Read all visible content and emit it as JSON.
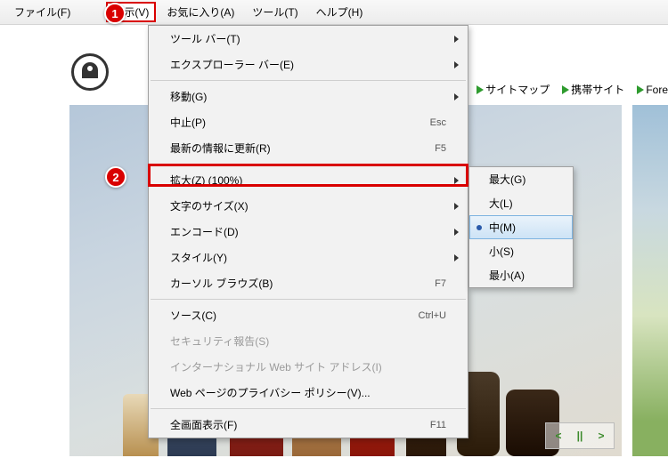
{
  "menubar": {
    "file": "ファイル(F)",
    "view": "表示(V)",
    "favorites": "お気に入り(A)",
    "tools": "ツール(T)",
    "help": "ヘルプ(H)"
  },
  "callouts": {
    "one": "1",
    "two": "2"
  },
  "headerlinks": {
    "sitemap": "サイトマップ",
    "mobile": "携帯サイト",
    "foreign": "Fore"
  },
  "dropdown": {
    "toolbars": "ツール バー(T)",
    "explorer_bars": "エクスプローラー バー(E)",
    "goto": "移動(G)",
    "stop": "中止(P)",
    "stop_sc": "Esc",
    "refresh": "最新の情報に更新(R)",
    "refresh_sc": "F5",
    "zoom": "拡大(Z) (100%)",
    "text_size": "文字のサイズ(X)",
    "encoding": "エンコード(D)",
    "style": "スタイル(Y)",
    "caret": "カーソル ブラウズ(B)",
    "caret_sc": "F7",
    "source": "ソース(C)",
    "source_sc": "Ctrl+U",
    "security": "セキュリティ報告(S)",
    "intl": "インターナショナル Web サイト アドレス(I)",
    "privacy": "Web ページのプライバシー ポリシー(V)...",
    "fullscreen": "全画面表示(F)",
    "fullscreen_sc": "F11"
  },
  "submenu": {
    "largest": "最大(G)",
    "larger": "大(L)",
    "medium": "中(M)",
    "smaller": "小(S)",
    "smallest": "最小(A)"
  },
  "carousel": {
    "prev": "<",
    "pause": "||",
    "next": ">"
  }
}
